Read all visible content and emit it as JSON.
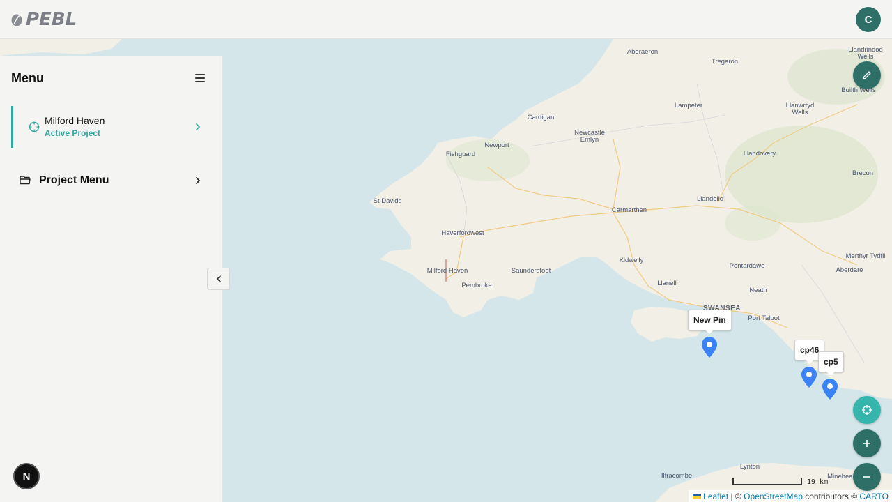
{
  "header": {
    "logo_text": "PEBL",
    "avatar_initial": "C"
  },
  "sidebar": {
    "title": "Menu",
    "project": {
      "name": "Milford Haven",
      "status": "Active Project"
    },
    "project_menu_label": "Project Menu"
  },
  "badge": {
    "label": "N"
  },
  "map": {
    "labels": [
      "Aberaeron",
      "Tregaron",
      "Llandrindod Wells",
      "Builth Wells",
      "Lampeter",
      "Llanwrtyd Wells",
      "Cardigan",
      "Newcastle Emlyn",
      "Newport",
      "Fishguard",
      "Llandovery",
      "Brecon",
      "St Davids",
      "Carmarthen",
      "Llandeilo",
      "Haverfordwest",
      "Milford Haven",
      "Saundersfoot",
      "Pembroke",
      "Kidwelly",
      "Pontardawe",
      "Merthyr Tydfil",
      "Aberdare",
      "Llanelli",
      "Neath",
      "SWANSEA",
      "Port Talbot",
      "Lynton",
      "Ilfracombe",
      "Minehead"
    ],
    "pins": [
      {
        "label": "New Pin"
      },
      {
        "label": "cp46"
      },
      {
        "label": "cp5"
      }
    ],
    "scale_label": "19 km",
    "attribution": {
      "leaflet": "Leaflet",
      "sep1": " | © ",
      "osm": "OpenStreetMap",
      "contrib": " contributors © ",
      "carto": "CARTO"
    }
  },
  "colors": {
    "accent": "#2eaaa0",
    "fab": "#2e6f67",
    "pin": "#3b82f6",
    "sea": "#d4e6ea",
    "land": "#f2efe6"
  },
  "icons": {
    "edit": "pencil-icon",
    "locate": "crosshair-icon",
    "zoom_in": "plus-icon",
    "zoom_out": "minus-icon"
  }
}
